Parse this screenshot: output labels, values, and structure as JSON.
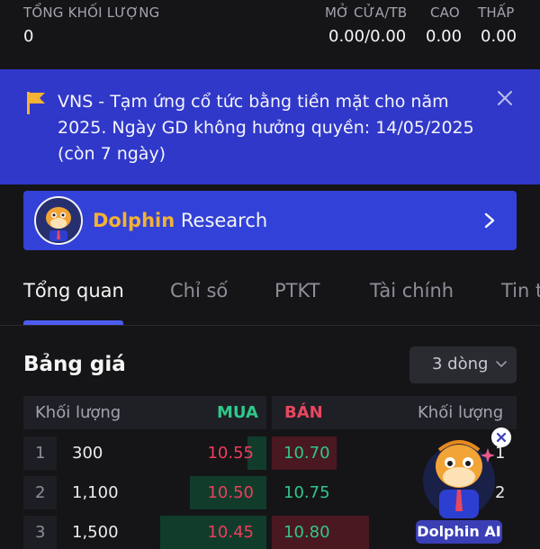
{
  "stats": {
    "total_volume_label": "TỔNG KHỐI LƯỢNG",
    "total_volume_value": "0",
    "open_avg_label": "MỞ CỬA/TB",
    "open_avg_value": "0.00/0.00",
    "high_label": "CAO",
    "high_value": "0.00",
    "low_label": "THẤP",
    "low_value": "0.00"
  },
  "notice": {
    "text": "VNS - Tạm ứng cổ tức bằng tiền mặt cho năm 2025. Ngày GD không hưởng quyền: 14/05/2025 (còn 7 ngày)",
    "flag_icon": "flag-icon",
    "close_icon": "close-icon",
    "flag_color": "#f2b233"
  },
  "research": {
    "brand": "Dolphin",
    "rest": " Research",
    "chevron_icon": "chevron-right-icon"
  },
  "tabs": [
    {
      "label": "Tổng quan",
      "active": true
    },
    {
      "label": "Chỉ số",
      "active": false
    },
    {
      "label": "PTKT",
      "active": false
    },
    {
      "label": "Tài chính",
      "active": false
    },
    {
      "label": "Tin t",
      "active": false
    }
  ],
  "price_board": {
    "title": "Bảng giá",
    "rows_select": "3 dòng",
    "headers": {
      "buy_volume": "Khối lượng",
      "buy": "MUA",
      "sell": "BÁN",
      "sell_volume": "Khối lượng"
    },
    "rows": [
      {
        "index": "1",
        "buy_volume": "300",
        "buy_price": "10.55",
        "sell_price": "10.70",
        "sell_volume": "1",
        "buy_depth": 0.18,
        "sell_depth": 0.6
      },
      {
        "index": "2",
        "buy_volume": "1,100",
        "buy_price": "10.50",
        "sell_price": "10.75",
        "sell_volume": "2",
        "buy_depth": 0.72,
        "sell_depth": 0.0
      },
      {
        "index": "3",
        "buy_volume": "1,500",
        "buy_price": "10.45",
        "sell_price": "10.80",
        "sell_volume": "",
        "buy_depth": 1.0,
        "sell_depth": 0.9
      }
    ]
  },
  "dolphin_ai": {
    "label": "Dolphin AI",
    "close_icon": "close-icon"
  },
  "colors": {
    "accent": "#4c5cf2",
    "banner": "#3038c9",
    "research_card": "#3241d8",
    "buy": "#2fc88b",
    "sell": "#e8475e"
  }
}
